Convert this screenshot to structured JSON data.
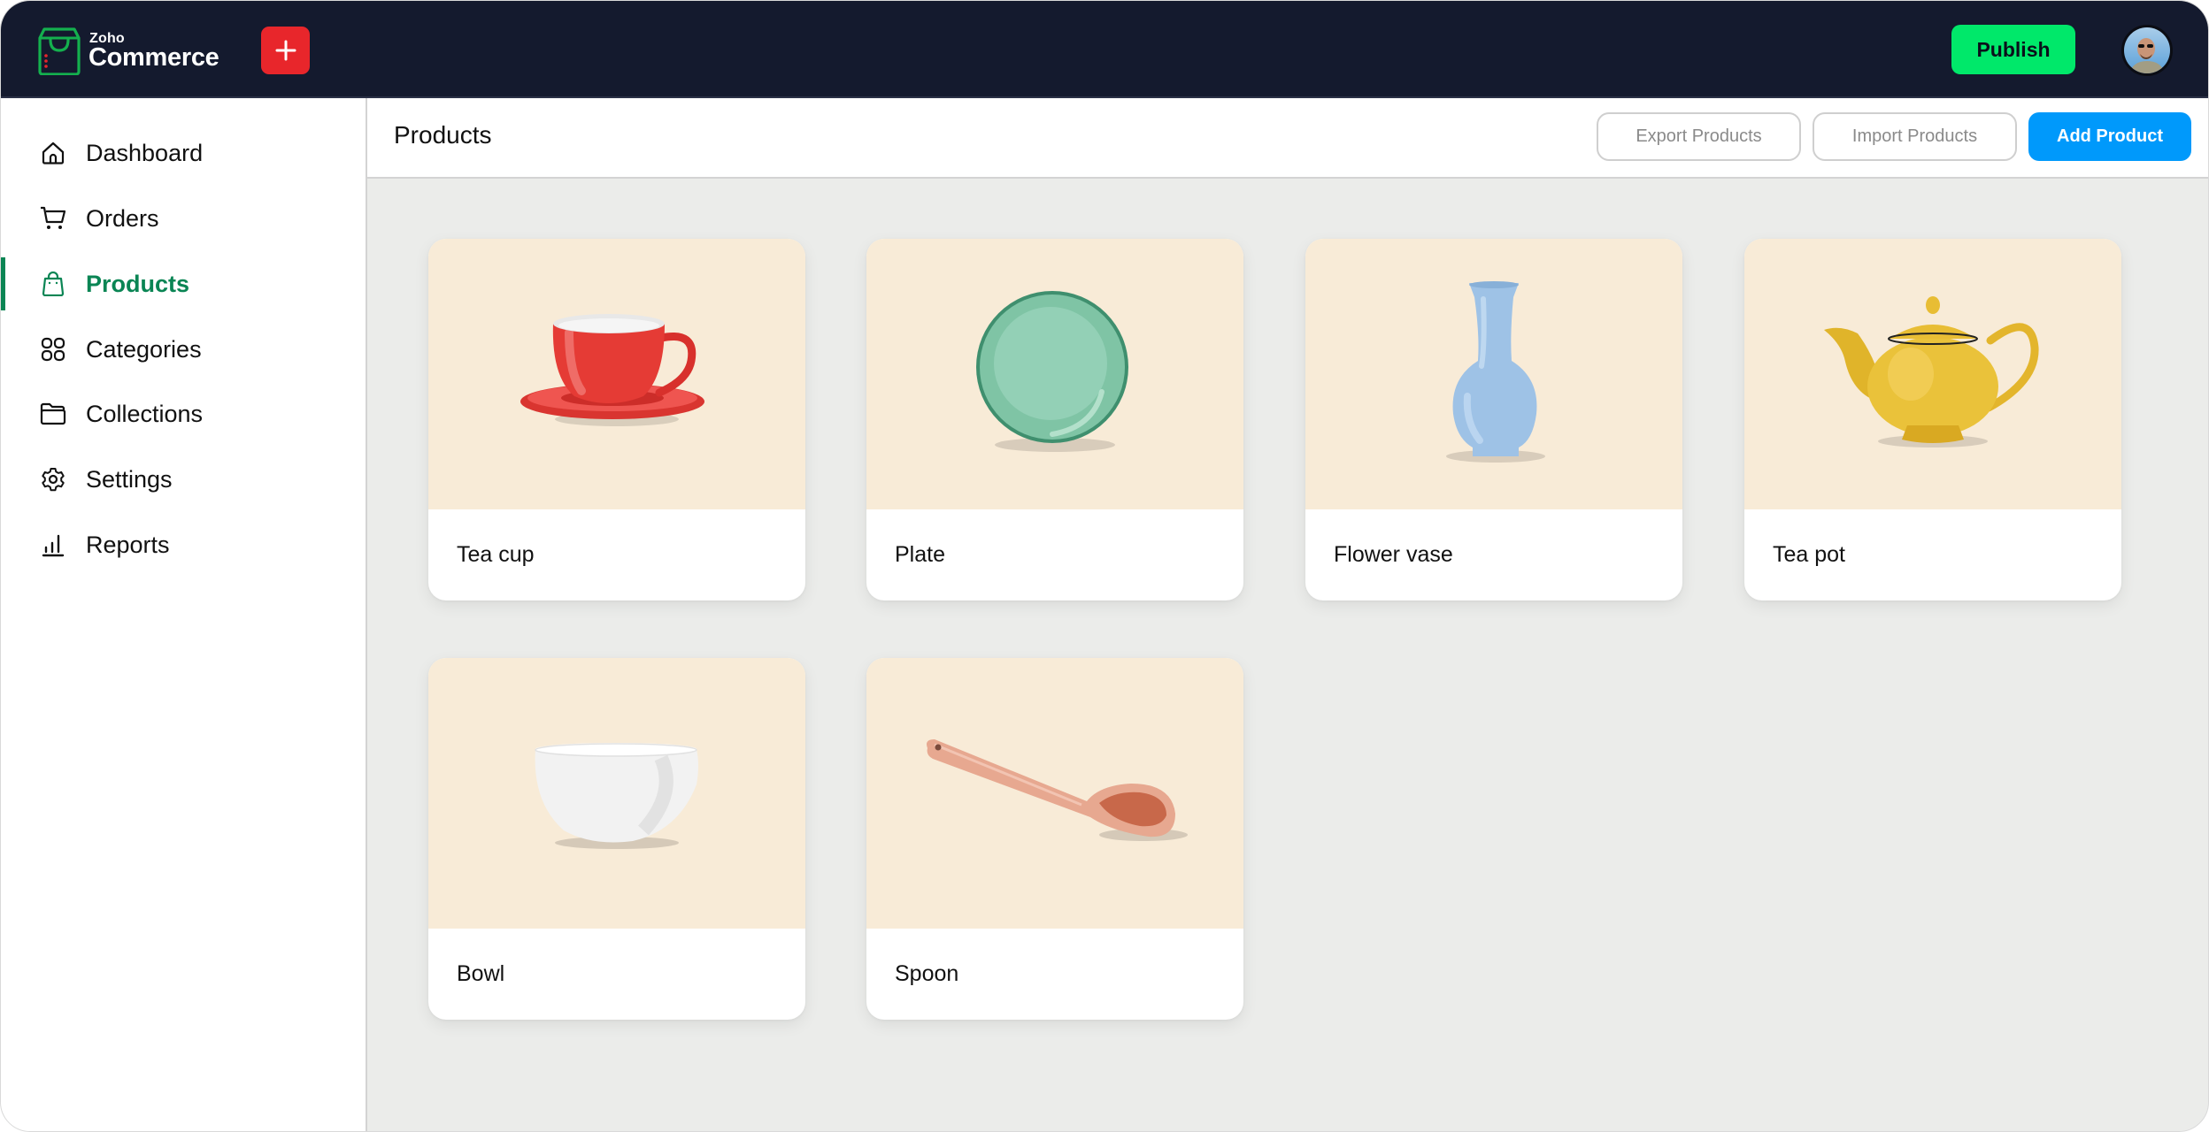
{
  "header": {
    "logo_small": "Zoho",
    "logo_big": "Commerce",
    "create_icon": "plus-icon",
    "publish_label": "Publish",
    "avatar": "user-avatar",
    "colors": {
      "topbar_bg": "#141a2e",
      "create_bg": "#e8262b",
      "publish_bg": "#00e86a"
    }
  },
  "sidebar": {
    "active_color": "#0a8554",
    "items": [
      {
        "label": "Dashboard",
        "icon": "home-icon",
        "active": false
      },
      {
        "label": "Orders",
        "icon": "cart-icon",
        "active": false
      },
      {
        "label": "Products",
        "icon": "shopping-bag-icon",
        "active": true
      },
      {
        "label": "Categories",
        "icon": "grid-icon",
        "active": false
      },
      {
        "label": "Collections",
        "icon": "folder-icon",
        "active": false
      },
      {
        "label": "Settings",
        "icon": "gear-icon",
        "active": false
      },
      {
        "label": "Reports",
        "icon": "bar-chart-icon",
        "active": false
      }
    ]
  },
  "main": {
    "title": "Products",
    "actions": {
      "export_label": "Export Products",
      "import_label": "Import Products",
      "add_label": "Add Product",
      "add_color": "#0099fb"
    },
    "products": [
      {
        "name": "Tea cup",
        "image": "red-tea-cup-with-saucer"
      },
      {
        "name": "Plate",
        "image": "green-plate"
      },
      {
        "name": "Flower vase",
        "image": "light-blue-vase"
      },
      {
        "name": "Tea pot",
        "image": "yellow-teapot"
      },
      {
        "name": "Bowl",
        "image": "white-bowl"
      },
      {
        "name": "Spoon",
        "image": "pink-ceramic-spoon"
      }
    ]
  }
}
